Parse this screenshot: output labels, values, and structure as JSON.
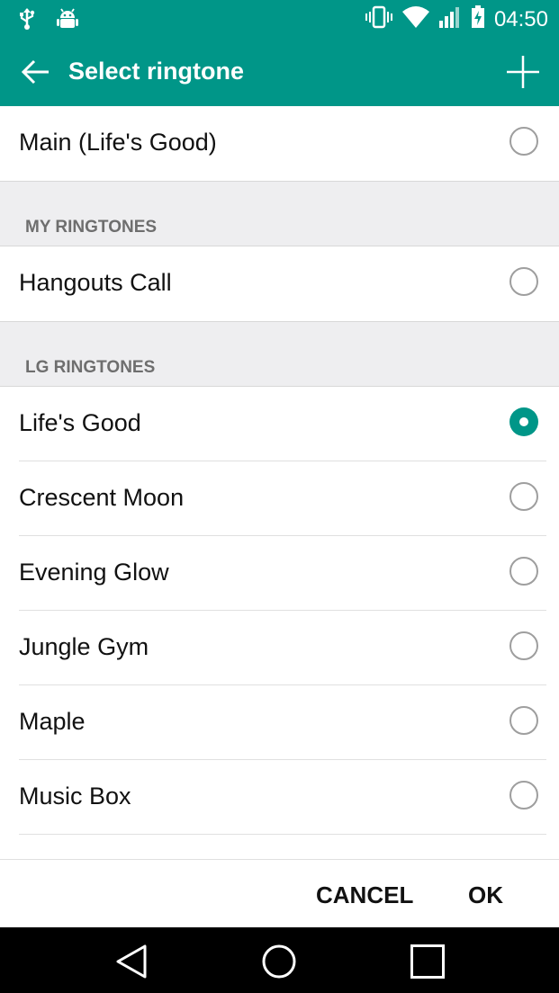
{
  "status_bar": {
    "time": "04:50",
    "icons_left": [
      "usb-icon",
      "android-debug-icon"
    ],
    "icons_right": [
      "vibrate-icon",
      "wifi-icon",
      "signal-icon",
      "battery-charging-icon"
    ]
  },
  "app_bar": {
    "title": "Select ringtone",
    "back_icon": "arrow-back-icon",
    "action_icon": "add-icon"
  },
  "list": {
    "default": {
      "label": "Main (Life's Good)",
      "selected": false
    },
    "sections": [
      {
        "header": "MY RINGTONES",
        "items": [
          {
            "label": "Hangouts Call",
            "selected": false
          }
        ]
      },
      {
        "header": "LG RINGTONES",
        "items": [
          {
            "label": "Life's Good",
            "selected": true
          },
          {
            "label": "Crescent Moon",
            "selected": false
          },
          {
            "label": "Evening Glow",
            "selected": false
          },
          {
            "label": "Jungle Gym",
            "selected": false
          },
          {
            "label": "Maple",
            "selected": false
          },
          {
            "label": "Music Box",
            "selected": false
          }
        ]
      }
    ]
  },
  "dialog_buttons": {
    "cancel": "CANCEL",
    "ok": "OK"
  },
  "colors": {
    "accent": "#009688",
    "section_bg": "#eeeef0"
  }
}
